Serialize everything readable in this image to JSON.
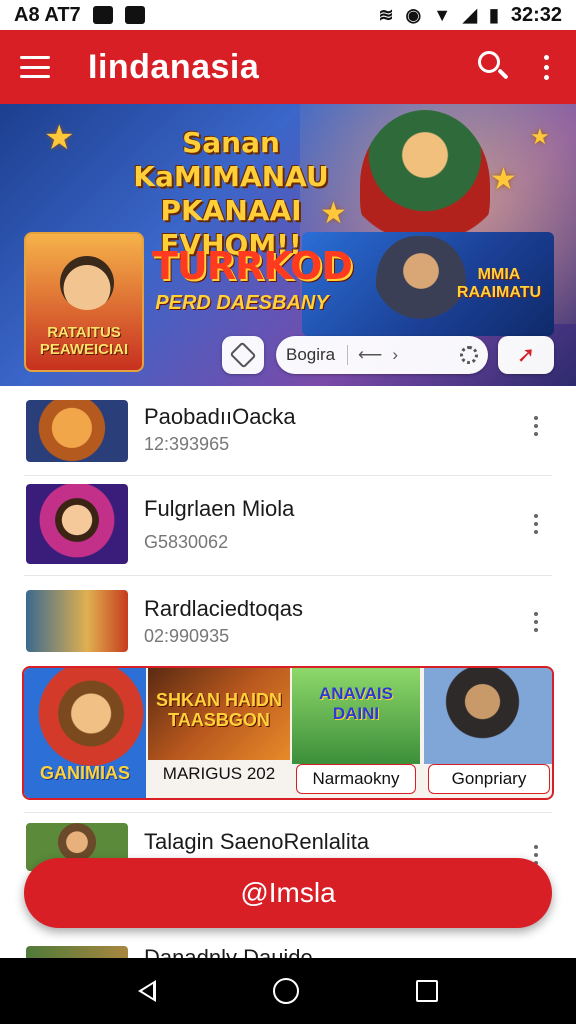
{
  "status_bar": {
    "left_text": "A8 AT7",
    "time": "32:32"
  },
  "app_bar": {
    "title": "Iindanasia",
    "search_icon": "search-icon",
    "menu_icon": "more-vert-icon"
  },
  "banner": {
    "headline": "Sanan KaMIMANAU PKANAAI FVHQM!!",
    "card_left_label": "RATAITUS PEAWEICIAI",
    "card_mid_title": "TURRKOD",
    "card_mid_subtitle": "PERD DAESBANY",
    "card_right_label": "MMIA RAAIMATU",
    "search_pill_text": "Bogira",
    "share_icon": "share-icon"
  },
  "list": [
    {
      "title": "PaobadııOacka",
      "subtitle": "12:393965"
    },
    {
      "title": "Fulgrlaen Miola",
      "subtitle": "G5830062"
    },
    {
      "title": "Rardlaciedtoqas",
      "subtitle": "02:990935"
    },
    {
      "title": "Talagin SaenoRenlalita",
      "subtitle": ""
    },
    {
      "title": "Danadnly Dauide",
      "subtitle": ""
    }
  ],
  "carousel": [
    {
      "art_text": "GANIMIAS",
      "caption": ""
    },
    {
      "art_text": "SHKAN HAIDN TAASBGON",
      "caption": "MARIGUS 202"
    },
    {
      "art_text": "ANAVAIS DAINI",
      "caption": "Narmaokny"
    },
    {
      "art_text": "",
      "caption": "Gonpriary"
    }
  ],
  "fab": {
    "label": "@Imsla"
  },
  "colors": {
    "primary": "#d81f26",
    "banner_blue": "#1c3f8f"
  }
}
